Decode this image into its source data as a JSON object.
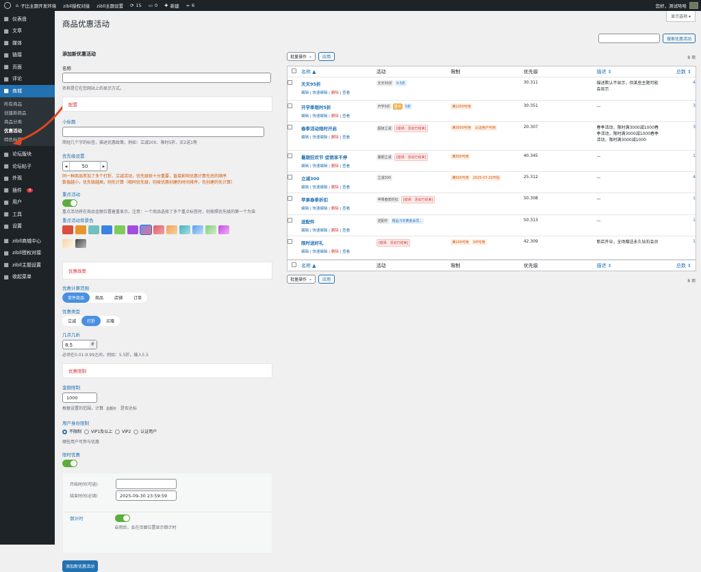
{
  "adminbar": {
    "site": "子比主题开发环境",
    "auth": "zibll授权对接",
    "settings": "zibll主题设置",
    "updates": "15",
    "comments": "0",
    "new": "新建",
    "links": "6",
    "greeting": "您好，测试哈哈"
  },
  "sidebar": {
    "items": [
      {
        "label": "仪表盘",
        "icon": "dashboard-icon"
      },
      {
        "label": "文章",
        "icon": "pin-icon"
      },
      {
        "label": "媒体",
        "icon": "media-icon"
      },
      {
        "label": "链接",
        "icon": "link-icon"
      },
      {
        "label": "页面",
        "icon": "page-icon"
      },
      {
        "label": "评论",
        "icon": "comment-icon"
      },
      {
        "label": "商城",
        "icon": "shop-icon"
      }
    ],
    "shop_sub": [
      "所有商品",
      "创建新商品",
      "商品分类",
      "优惠活动",
      "特色标签"
    ],
    "items2": [
      {
        "label": "论坛版块",
        "icon": "forum-icon"
      },
      {
        "label": "论坛帖子",
        "icon": "forum-post-icon"
      },
      {
        "label": "外观",
        "icon": "appearance-icon"
      },
      {
        "label": "插件",
        "icon": "plugin-icon",
        "badge": "9"
      },
      {
        "label": "用户",
        "icon": "user-icon"
      },
      {
        "label": "工具",
        "icon": "tool-icon"
      },
      {
        "label": "设置",
        "icon": "settings-icon"
      }
    ],
    "items3": [
      {
        "label": "zibll商城中心",
        "icon": "gear-icon"
      },
      {
        "label": "zibll授权对接",
        "icon": "gear-icon"
      },
      {
        "label": "zibll主题设置",
        "icon": "gear-icon"
      },
      {
        "label": "收起菜单",
        "icon": "collapse-icon"
      }
    ]
  },
  "page": {
    "title": "商品优惠活动",
    "screen_options": "显示选项 ▾",
    "search_button": "搜索优惠活动"
  },
  "form": {
    "heading": "添加新优惠活动",
    "name_label": "名称",
    "name_desc": "名称是它在您网站上的显示方式。",
    "config_section": "配置",
    "subtitle_label": "小标题",
    "subtitle_desc": "简短几个字的标签，描述优惠政策，例如：立减200、限时5折、买2送1等",
    "priority_label": "优先级设置",
    "priority_value": "50",
    "priority_warn": "同一种商品参加了多个打折、立减活动，优先级就十分重要，直接影响优惠计算先后的顺序\n数值越小，优先级越高，则先计算（相同优先级，则按优惠创建的时间排序，先创建的先计算）",
    "highlight_label": "重点活动",
    "highlight_desc": "重点活动将在商品金额位置着重显示，注意：一个商品选择了多个重点标签时，则按照优先级的第一个为准",
    "bg_label": "重点活动背景色",
    "policy_section": "优惠政策",
    "scope_label": "优惠计算范围",
    "scope_options": [
      "单件商品",
      "商品",
      "店铺",
      "订单"
    ],
    "type_label": "优惠类型",
    "type_options": [
      "立减",
      "打折",
      "买赠"
    ],
    "discount_label": "几点几折",
    "discount_value": "8.5",
    "discount_unit": "折",
    "discount_desc": "必须在0.01-9.99之间，例如：5.5折，输入5.5",
    "limit_section": "优惠限制",
    "amount_label": "金额限制",
    "amount_value": "1000",
    "amount_desc_a": "根据设置的范围，计算",
    "amount_desc_tag": "总额价",
    "amount_desc_b": "是否达标",
    "user_label": "用户身份限制",
    "user_options": [
      "不限制",
      "VIP1及以上",
      "VIP2",
      "认证用户"
    ],
    "user_desc": "哪些用户可参与优惠",
    "timed_label": "限时优惠",
    "start_label": "开始时间(可选)",
    "end_label": "结束时间(必填)",
    "end_value": "2025-09-30 23:59:59",
    "countdown_label": "倒计时",
    "countdown_desc": "启用后，会在页面位置显示倒计时",
    "submit": "添加新优惠活动"
  },
  "table": {
    "bulk": "批量操作",
    "apply": "应用",
    "count": "8 项",
    "headers": [
      "名称 ▲",
      "活动",
      "限制",
      "优先级",
      "描述 ⇕",
      "总数 ⇕"
    ],
    "action_labels": {
      "edit": "编辑",
      "quick": "快速编辑",
      "del": "删除",
      "view": "查看"
    },
    "rows": [
      {
        "name": "天天95折",
        "tags": [
          [
            "天天95折",
            "g"
          ],
          [
            "9.5折",
            "b"
          ]
        ],
        "limits": [],
        "priority": "30.311",
        "desc": "描述默认不显示，但某些主题可能会显示",
        "count": "4"
      },
      {
        "name": "开学季限时5折",
        "tags": [
          [
            "开学5折",
            "g"
          ],
          [
            "重点",
            "os"
          ],
          [
            "5折",
            "b"
          ]
        ],
        "limits": [
          [
            "满1000可用",
            "o"
          ]
        ],
        "priority": "30.351",
        "desc": "—",
        "count": "3"
      },
      {
        "name": "春季活动限时开启",
        "tags": [
          [
            "超级立减",
            "g"
          ],
          [
            "[错误：活动已结束]",
            "r"
          ]
        ],
        "limits": [
          [
            "满3000可用",
            "o"
          ],
          [
            "认证用户可用",
            "o"
          ]
        ],
        "priority": "20.307",
        "desc": "春季活动，限时满3000减1000春季活动，限时满3000减1000春季活动，限时满3000减1000",
        "count": "3"
      },
      {
        "name": "暑期狂欢节 促销享不停",
        "tags": [
          [
            "暑期立减",
            "g"
          ],
          [
            "[错误：活动已结束]",
            "r"
          ]
        ],
        "limits": [
          [
            "满300可用",
            "o"
          ]
        ],
        "priority": "40.345",
        "desc": "—",
        "count": "1"
      },
      {
        "name": "立减300",
        "tags": [
          [
            "立减300",
            "g"
          ]
        ],
        "limits": [
          [
            "满500可用",
            "o"
          ],
          [
            "2025-07-20开始",
            "o"
          ]
        ],
        "priority": "25.312",
        "desc": "—",
        "count": "4"
      },
      {
        "name": "苹果春季折扣",
        "tags": [
          [
            "苹果春季折扣",
            "g"
          ],
          [
            "[错误：活动已结束]",
            "r"
          ]
        ],
        "limits": [],
        "priority": "50.308",
        "desc": "—",
        "count": "1"
      },
      {
        "name": "送配件",
        "tags": [
          [
            "送配件",
            "g"
          ],
          [
            "赠品:5天黄金会员...",
            "b"
          ]
        ],
        "limits": [],
        "priority": "50.313",
        "desc": "—",
        "count": "1"
      },
      {
        "name": "限时送好礼",
        "tags": [
          [
            "[错误：活动已结束]",
            "r"
          ]
        ],
        "limits": [
          [
            "满100可用",
            "o"
          ],
          [
            "VIP可用",
            "o"
          ]
        ],
        "priority": "42.309",
        "desc": "新店开业，全场赠送永久钻石会员",
        "count": "1"
      }
    ]
  }
}
